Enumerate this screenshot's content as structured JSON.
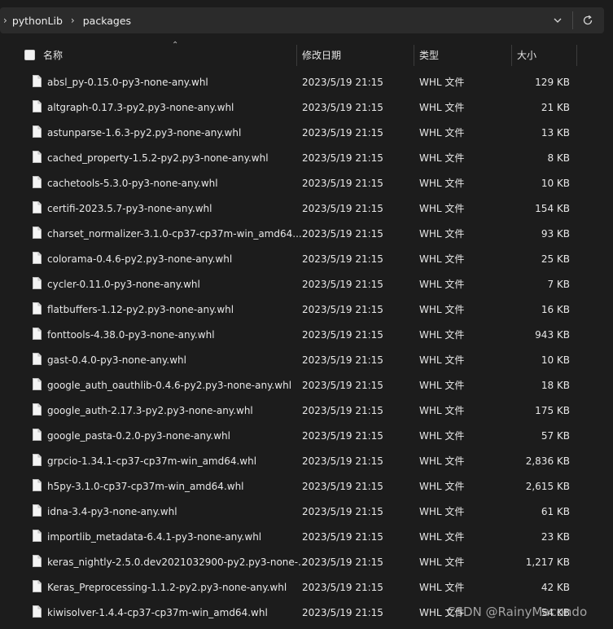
{
  "breadcrumb": {
    "items": [
      "pythonLib",
      "packages"
    ]
  },
  "columns": {
    "name": "名称",
    "date": "修改日期",
    "type": "类型",
    "size": "大小"
  },
  "files": [
    {
      "name": "absl_py-0.15.0-py3-none-any.whl",
      "date": "2023/5/19 21:15",
      "type": "WHL 文件",
      "size": "129 KB"
    },
    {
      "name": "altgraph-0.17.3-py2.py3-none-any.whl",
      "date": "2023/5/19 21:15",
      "type": "WHL 文件",
      "size": "21 KB"
    },
    {
      "name": "astunparse-1.6.3-py2.py3-none-any.whl",
      "date": "2023/5/19 21:15",
      "type": "WHL 文件",
      "size": "13 KB"
    },
    {
      "name": "cached_property-1.5.2-py2.py3-none-any.whl",
      "date": "2023/5/19 21:15",
      "type": "WHL 文件",
      "size": "8 KB"
    },
    {
      "name": "cachetools-5.3.0-py3-none-any.whl",
      "date": "2023/5/19 21:15",
      "type": "WHL 文件",
      "size": "10 KB"
    },
    {
      "name": "certifi-2023.5.7-py3-none-any.whl",
      "date": "2023/5/19 21:15",
      "type": "WHL 文件",
      "size": "154 KB"
    },
    {
      "name": "charset_normalizer-3.1.0-cp37-cp37m-win_amd64....",
      "date": "2023/5/19 21:15",
      "type": "WHL 文件",
      "size": "93 KB"
    },
    {
      "name": "colorama-0.4.6-py2.py3-none-any.whl",
      "date": "2023/5/19 21:15",
      "type": "WHL 文件",
      "size": "25 KB"
    },
    {
      "name": "cycler-0.11.0-py3-none-any.whl",
      "date": "2023/5/19 21:15",
      "type": "WHL 文件",
      "size": "7 KB"
    },
    {
      "name": "flatbuffers-1.12-py2.py3-none-any.whl",
      "date": "2023/5/19 21:15",
      "type": "WHL 文件",
      "size": "16 KB"
    },
    {
      "name": "fonttools-4.38.0-py3-none-any.whl",
      "date": "2023/5/19 21:15",
      "type": "WHL 文件",
      "size": "943 KB"
    },
    {
      "name": "gast-0.4.0-py3-none-any.whl",
      "date": "2023/5/19 21:15",
      "type": "WHL 文件",
      "size": "10 KB"
    },
    {
      "name": "google_auth_oauthlib-0.4.6-py2.py3-none-any.whl",
      "date": "2023/5/19 21:15",
      "type": "WHL 文件",
      "size": "18 KB"
    },
    {
      "name": "google_auth-2.17.3-py2.py3-none-any.whl",
      "date": "2023/5/19 21:15",
      "type": "WHL 文件",
      "size": "175 KB"
    },
    {
      "name": "google_pasta-0.2.0-py3-none-any.whl",
      "date": "2023/5/19 21:15",
      "type": "WHL 文件",
      "size": "57 KB"
    },
    {
      "name": "grpcio-1.34.1-cp37-cp37m-win_amd64.whl",
      "date": "2023/5/19 21:15",
      "type": "WHL 文件",
      "size": "2,836 KB"
    },
    {
      "name": "h5py-3.1.0-cp37-cp37m-win_amd64.whl",
      "date": "2023/5/19 21:15",
      "type": "WHL 文件",
      "size": "2,615 KB"
    },
    {
      "name": "idna-3.4-py3-none-any.whl",
      "date": "2023/5/19 21:15",
      "type": "WHL 文件",
      "size": "61 KB"
    },
    {
      "name": "importlib_metadata-6.4.1-py3-none-any.whl",
      "date": "2023/5/19 21:15",
      "type": "WHL 文件",
      "size": "23 KB"
    },
    {
      "name": "keras_nightly-2.5.0.dev2021032900-py2.py3-none-...",
      "date": "2023/5/19 21:15",
      "type": "WHL 文件",
      "size": "1,217 KB"
    },
    {
      "name": "Keras_Preprocessing-1.1.2-py2.py3-none-any.whl",
      "date": "2023/5/19 21:15",
      "type": "WHL 文件",
      "size": "42 KB"
    },
    {
      "name": "kiwisolver-1.4.4-cp37-cp37m-win_amd64.whl",
      "date": "2023/5/19 21:15",
      "type": "WHL 文件",
      "size": "54 KB"
    }
  ],
  "watermark": "CSDN @RainyMacondo",
  "icons": {
    "chevron_down": "chevron-down-icon",
    "refresh": "refresh-icon",
    "file": "file-icon"
  },
  "colors": {
    "background": "#1c1c1c",
    "address_bar": "#2b2b2b",
    "text": "#e8e8e8"
  }
}
